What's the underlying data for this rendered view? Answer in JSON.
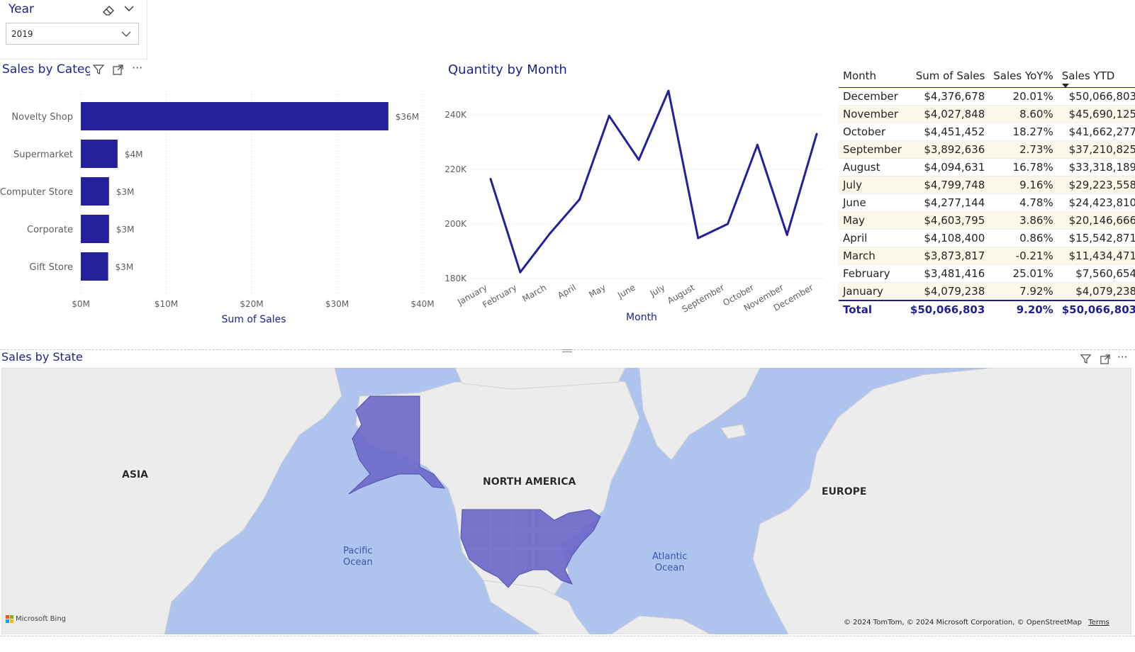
{
  "slicer": {
    "title": "Year",
    "selected": "2019"
  },
  "category_chart": {
    "title": "Sales by Catego",
    "colors": {
      "bar": "#23209a",
      "axis_text": "#605e5c"
    }
  },
  "month_chart": {
    "title": "Quantity by Month"
  },
  "table": {
    "headers": [
      "Month",
      "Sum of Sales",
      "Sales YoY%",
      "Sales YTD"
    ],
    "rows": [
      [
        "December",
        "$4,376,678",
        "20.01%",
        "$50,066,803"
      ],
      [
        "November",
        "$4,027,848",
        "8.60%",
        "$45,690,125"
      ],
      [
        "October",
        "$4,451,452",
        "18.27%",
        "$41,662,277"
      ],
      [
        "September",
        "$3,892,636",
        "2.73%",
        "$37,210,825"
      ],
      [
        "August",
        "$4,094,631",
        "16.78%",
        "$33,318,189"
      ],
      [
        "July",
        "$4,799,748",
        "9.16%",
        "$29,223,558"
      ],
      [
        "June",
        "$4,277,144",
        "4.78%",
        "$24,423,810"
      ],
      [
        "May",
        "$4,603,795",
        "3.86%",
        "$20,146,666"
      ],
      [
        "April",
        "$4,108,400",
        "0.86%",
        "$15,542,871"
      ],
      [
        "March",
        "$3,873,817",
        "-0.21%",
        "$11,434,471"
      ],
      [
        "February",
        "$3,481,416",
        "25.01%",
        "$7,560,654"
      ],
      [
        "January",
        "$4,079,238",
        "7.92%",
        "$4,079,238"
      ]
    ],
    "total": [
      "Total",
      "$50,066,803",
      "9.20%",
      "$50,066,803"
    ],
    "sort_indicator": "Sales YTD descending"
  },
  "map": {
    "title": "Sales by State",
    "continent_labels": [
      "ASIA",
      "NORTH AMERICA",
      "EUROPE"
    ],
    "ocean_labels": [
      [
        "Pacific",
        "Ocean"
      ],
      [
        "Atlantic",
        "Ocean"
      ]
    ],
    "bing_logo": "Microsoft Bing",
    "attribution": "© 2024 TomTom, © 2024 Microsoft Corporation, © OpenStreetMap",
    "terms": "Terms",
    "colors": {
      "water": "#aec3ee",
      "land": "#ececec",
      "highlight": "#6b68c8"
    }
  },
  "chart_data": [
    {
      "type": "bar",
      "orientation": "horizontal",
      "title": "Sales by Catego",
      "categories": [
        "Novelty Shop",
        "Supermarket",
        "Computer Store",
        "Corporate",
        "Gift Store"
      ],
      "values": [
        36,
        4.3,
        3.3,
        3.3,
        3.2
      ],
      "data_labels": [
        "$36M",
        "$4M",
        "$3M",
        "$3M",
        "$3M"
      ],
      "xlabel": "Sum of Sales",
      "ylabel": "",
      "xlim": [
        0,
        40
      ],
      "x_ticks": [
        "$0M",
        "$10M",
        "$20M",
        "$30M",
        "$40M"
      ],
      "grid": "vertical dotted",
      "color": "#23209a"
    },
    {
      "type": "line",
      "title": "Quantity by Month",
      "x": [
        "January",
        "February",
        "March",
        "April",
        "May",
        "June",
        "July",
        "August",
        "September",
        "October",
        "November",
        "December"
      ],
      "values": [
        216.5,
        182.3,
        196.5,
        209,
        239.6,
        223.5,
        248.8,
        194.8,
        200,
        229,
        196,
        233
      ],
      "xlabel": "Month",
      "ylabel": "",
      "ylim": [
        180,
        250
      ],
      "y_ticks": [
        "180K",
        "200K",
        "220K",
        "240K"
      ],
      "grid": "horizontal dotted",
      "color": "#23209a"
    }
  ]
}
